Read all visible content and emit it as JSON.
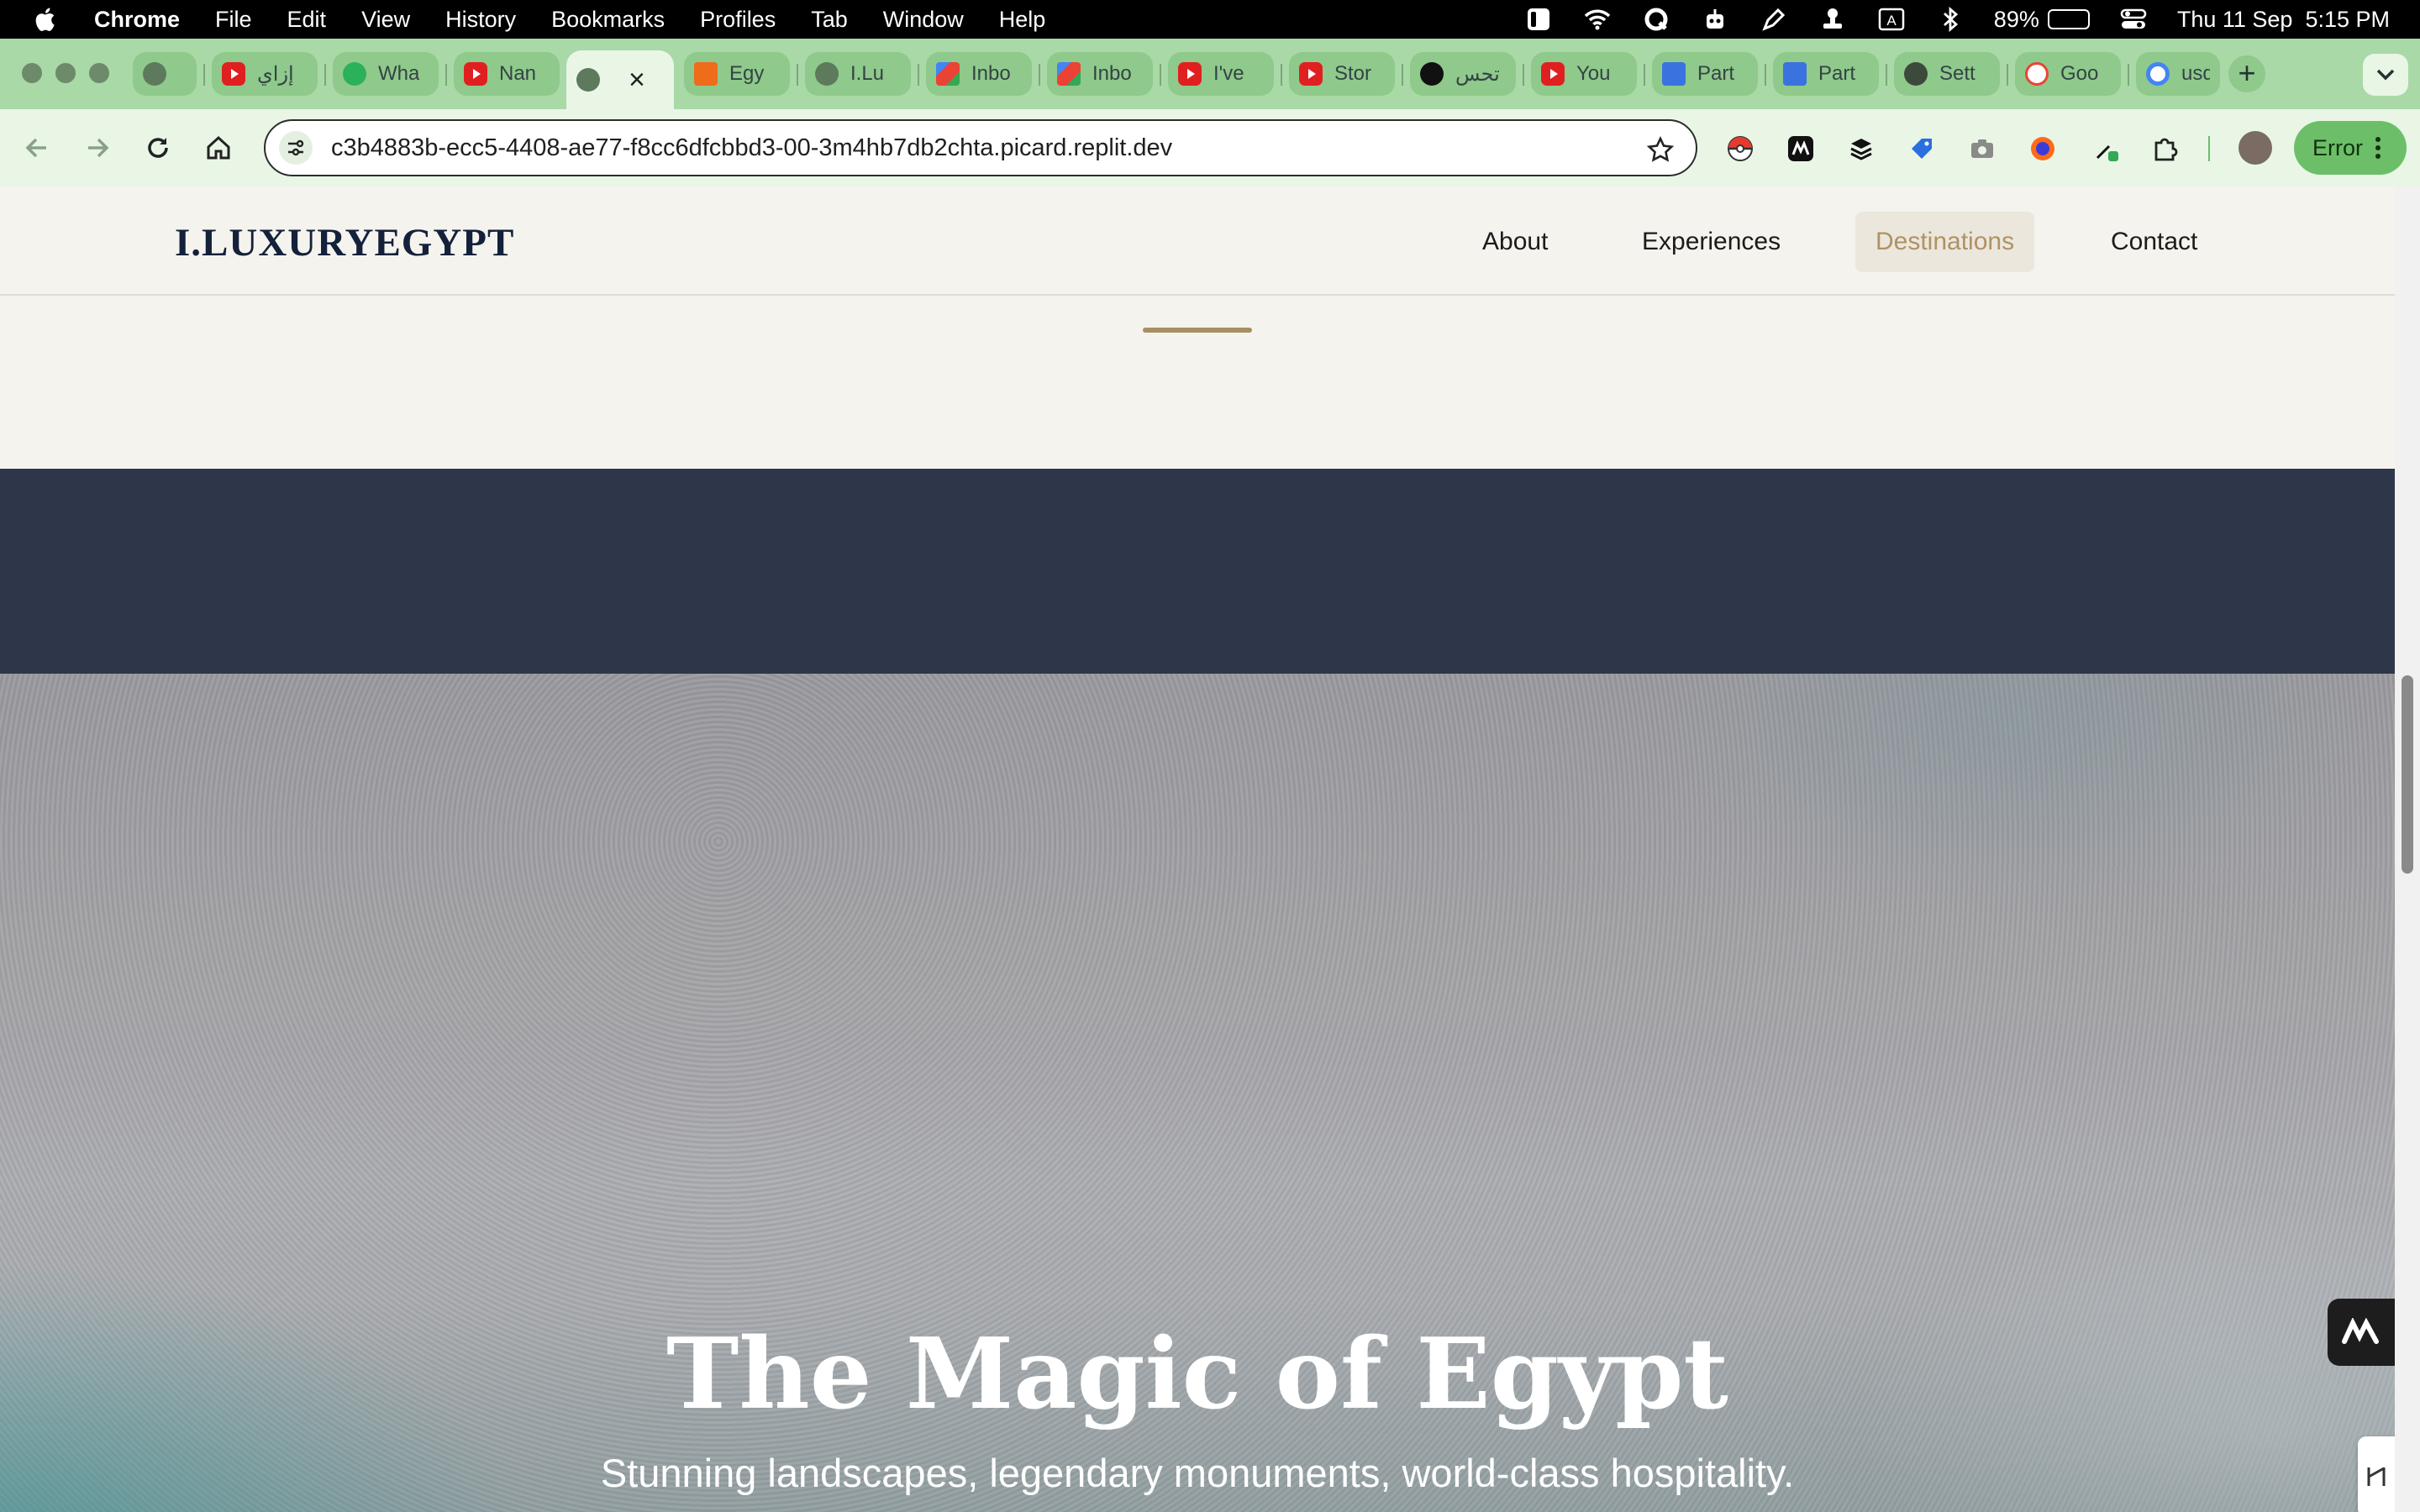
{
  "menubar": {
    "app": "Chrome",
    "items": [
      "File",
      "Edit",
      "View",
      "History",
      "Bookmarks",
      "Profiles",
      "Tab",
      "Window",
      "Help"
    ],
    "battery_percent": "89%",
    "battery_level": 0.89,
    "input_source": "A",
    "clock": "Thu 11 Sep  5:15 PM"
  },
  "tabs": [
    {
      "icon": "globe-icon",
      "title": ""
    },
    {
      "icon": "youtube-icon",
      "title": "إزاي"
    },
    {
      "icon": "whatsapp-icon",
      "title": "Wha"
    },
    {
      "icon": "youtube-icon",
      "title": "Nan"
    },
    {
      "icon": "globe-icon",
      "title": "",
      "active": true,
      "close": "×"
    },
    {
      "icon": "orange-icon",
      "title": "Egy"
    },
    {
      "icon": "globe-icon",
      "title": "I.Lu"
    },
    {
      "icon": "gmail-icon",
      "title": "Inbo"
    },
    {
      "icon": "gmail-icon",
      "title": "Inbo"
    },
    {
      "icon": "youtube-icon",
      "title": "I've"
    },
    {
      "icon": "youtube-icon",
      "title": "Stor"
    },
    {
      "icon": "dark-icon",
      "title": "تحس"
    },
    {
      "icon": "youtube-icon",
      "title": "You"
    },
    {
      "icon": "docs-icon",
      "title": "Part"
    },
    {
      "icon": "docs-icon",
      "title": "Part"
    },
    {
      "icon": "settings-icon",
      "title": "Sett"
    },
    {
      "icon": "key-icon",
      "title": "Goo"
    },
    {
      "icon": "google-icon",
      "title": "usd"
    }
  ],
  "new_tab": "+",
  "toolbar": {
    "url": "c3b4883b-ecc5-4408-ae77-f8cc6dfcbbd3-00-3m4hb7db2chta.picard.replit.dev",
    "error_label": "Error"
  },
  "site": {
    "logo": "I.LUXURYEGYPT",
    "nav": [
      {
        "label": "About"
      },
      {
        "label": "Experiences"
      },
      {
        "label": "Destinations",
        "active": true
      },
      {
        "label": "Contact"
      }
    ],
    "hero_title": "The Magic of Egypt",
    "hero_subtitle": "Stunning landscapes, legendary monuments, world-class hospitality."
  },
  "colors": {
    "accent_gold": "#b09264",
    "navy": "#2e3649",
    "tab_green": "#a9d9a6"
  }
}
